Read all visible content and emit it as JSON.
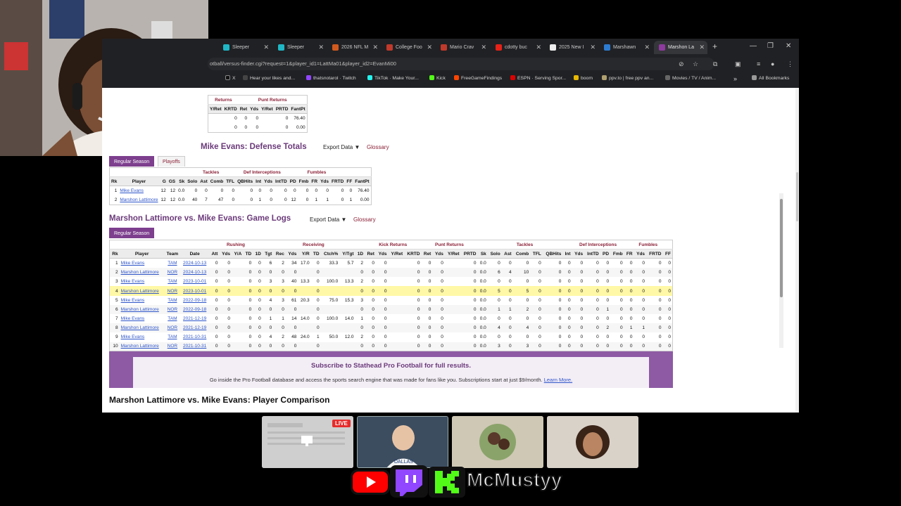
{
  "browser": {
    "tabs": [
      {
        "label": "Sleeper",
        "color": "#1fb7c6"
      },
      {
        "label": "Sleeper",
        "color": "#1fb7c6"
      },
      {
        "label": "2026 NFL M",
        "color": "#d2591e"
      },
      {
        "label": "College Foo",
        "color": "#c0392b"
      },
      {
        "label": "Mario Crav",
        "color": "#c0392b"
      },
      {
        "label": "cdotty buc",
        "color": "#e62117"
      },
      {
        "label": "2025 New I",
        "color": "#eeeeee"
      },
      {
        "label": "Marshawn",
        "color": "#2d7bd1"
      },
      {
        "label": "Marshon La",
        "color": "#8e3a9e"
      }
    ],
    "url": "otball/versus-finder.cgi?request=1&player_id1=LattMa01&player_id2=EvanMi00",
    "bookmarks": [
      "X",
      "Hear your likes and...",
      "thatsnotarol · Twitch",
      "TikTok · Make Your...",
      "Kick",
      "FreeGameFindings",
      "ESPN · Serving Spor...",
      "boom",
      "ppv.to | free ppv an...",
      "Movies / TV / Anim..."
    ],
    "all_bookmarks": "All Bookmarks",
    "overflow": "»"
  },
  "returns_table": {
    "headers_over": [
      "Returns",
      "Punt Returns"
    ],
    "headers": [
      "Y/Ret",
      "KRTD",
      "Ret",
      "Yds",
      "Y/Ret",
      "PRTD",
      "FantPt"
    ],
    "rows": [
      [
        "",
        "0",
        "0",
        "0",
        "",
        "0",
        "76.40"
      ],
      [
        "",
        "0",
        "0",
        "0",
        "",
        "0",
        "0.00"
      ]
    ]
  },
  "defense": {
    "title": "Mike Evans: Defense Totals",
    "export": "Export Data ▼",
    "glossary": "Glossary",
    "tab_regular": "Regular Season",
    "tab_playoffs": "Playoffs",
    "groups": [
      "Tackles",
      "Def Interceptions",
      "Fumbles"
    ],
    "headers": [
      "Rk",
      "Player",
      "G",
      "GS",
      "Sk",
      "Solo",
      "Ast",
      "Comb",
      "TFL",
      "QBHits",
      "Int",
      "Yds",
      "IntTD",
      "PD",
      "Fmb",
      "FR",
      "Yds",
      "FRTD",
      "FF",
      "FantPt"
    ],
    "rows": [
      [
        "1",
        "Mike Evans",
        "12",
        "12",
        "0.0",
        "0",
        "0",
        "0",
        "0",
        "0",
        "0",
        "0",
        "0",
        "0",
        "0",
        "0",
        "0",
        "0",
        "0",
        "76.40"
      ],
      [
        "2",
        "Marshon Lattimore",
        "12",
        "12",
        "0.0",
        "40",
        "7",
        "47",
        "0",
        "0",
        "1",
        "0",
        "0",
        "12",
        "0",
        "1",
        "1",
        "0",
        "1",
        "0.00"
      ]
    ]
  },
  "gamelogs": {
    "title": "Marshon Lattimore vs. Mike Evans: Game Logs",
    "export": "Export Data ▼",
    "glossary": "Glossary",
    "tab_regular": "Regular Season",
    "groups": [
      "Rushing",
      "Receiving",
      "Kick Returns",
      "Punt Returns",
      "Tackles",
      "Def Interceptions",
      "Fumbles"
    ],
    "headers": [
      "Rk",
      "Player",
      "Team",
      "Date",
      "Att",
      "Yds",
      "Y/A",
      "TD",
      "1D",
      "Tgt",
      "Rec",
      "Yds",
      "Y/R",
      "TD",
      "Ctch%",
      "Y/Tgt",
      "1D",
      "Ret",
      "Yds",
      "Y/Ret",
      "KRTD",
      "Ret",
      "Yds",
      "Y/Ret",
      "PRTD",
      "Sk",
      "Solo",
      "Ast",
      "Comb",
      "TFL",
      "QBHits",
      "Int",
      "Yds",
      "IntTD",
      "PD",
      "Fmb",
      "FR",
      "Yds",
      "FRTD",
      "FF"
    ],
    "rows": [
      [
        "1",
        "Mike Evans",
        "TAM",
        "2024-10-13",
        "0",
        "0",
        "",
        "0",
        "0",
        "6",
        "2",
        "34",
        "17.0",
        "0",
        "33.3",
        "5.7",
        "2",
        "0",
        "0",
        "",
        "0",
        "0",
        "0",
        "",
        "0",
        "0.0",
        "0",
        "0",
        "0",
        "0",
        "0",
        "0",
        "0",
        "0",
        "0",
        "0",
        "0",
        "0",
        "0",
        "0"
      ],
      [
        "2",
        "Marshon Lattimore",
        "NOR",
        "2024-10-13",
        "0",
        "0",
        "",
        "0",
        "0",
        "0",
        "0",
        "0",
        "",
        "0",
        "",
        "",
        "0",
        "0",
        "0",
        "",
        "0",
        "0",
        "0",
        "",
        "0",
        "0.0",
        "6",
        "4",
        "10",
        "0",
        "0",
        "0",
        "0",
        "0",
        "0",
        "0",
        "0",
        "0",
        "0",
        "0"
      ],
      [
        "3",
        "Mike Evans",
        "TAM",
        "2023-10-01",
        "0",
        "0",
        "",
        "0",
        "0",
        "3",
        "3",
        "40",
        "13.3",
        "0",
        "100.0",
        "13.3",
        "2",
        "0",
        "0",
        "",
        "0",
        "0",
        "0",
        "",
        "0",
        "0.0",
        "0",
        "0",
        "0",
        "0",
        "0",
        "0",
        "0",
        "0",
        "0",
        "0",
        "0",
        "0",
        "0",
        "0"
      ],
      [
        "4",
        "Marshon Lattimore",
        "NOR",
        "2023-10-01",
        "0",
        "0",
        "",
        "0",
        "0",
        "0",
        "0",
        "0",
        "",
        "0",
        "",
        "",
        "0",
        "0",
        "0",
        "",
        "0",
        "0",
        "0",
        "",
        "0",
        "0.0",
        "5",
        "0",
        "5",
        "0",
        "0",
        "0",
        "0",
        "0",
        "0",
        "0",
        "0",
        "0",
        "0",
        "0"
      ],
      [
        "5",
        "Mike Evans",
        "TAM",
        "2022-09-18",
        "0",
        "0",
        "",
        "0",
        "0",
        "4",
        "3",
        "61",
        "20.3",
        "0",
        "75.0",
        "15.3",
        "3",
        "0",
        "0",
        "",
        "0",
        "0",
        "0",
        "",
        "0",
        "0.0",
        "0",
        "0",
        "0",
        "0",
        "0",
        "0",
        "0",
        "0",
        "0",
        "0",
        "0",
        "0",
        "0",
        "0"
      ],
      [
        "6",
        "Marshon Lattimore",
        "NOR",
        "2022-09-18",
        "0",
        "0",
        "",
        "0",
        "0",
        "0",
        "0",
        "0",
        "",
        "0",
        "",
        "",
        "0",
        "0",
        "0",
        "",
        "0",
        "0",
        "0",
        "",
        "0",
        "0.0",
        "1",
        "1",
        "2",
        "0",
        "0",
        "0",
        "0",
        "0",
        "1",
        "0",
        "0",
        "0",
        "0",
        "0"
      ],
      [
        "7",
        "Mike Evans",
        "TAM",
        "2021-12-19",
        "0",
        "0",
        "",
        "0",
        "0",
        "1",
        "1",
        "14",
        "14.0",
        "0",
        "100.0",
        "14.0",
        "1",
        "0",
        "0",
        "",
        "0",
        "0",
        "0",
        "",
        "0",
        "0.0",
        "0",
        "0",
        "0",
        "0",
        "0",
        "0",
        "0",
        "0",
        "0",
        "0",
        "0",
        "0",
        "0",
        "0"
      ],
      [
        "8",
        "Marshon Lattimore",
        "NOR",
        "2021-12-19",
        "0",
        "0",
        "",
        "0",
        "0",
        "0",
        "0",
        "0",
        "",
        "0",
        "",
        "",
        "0",
        "0",
        "0",
        "",
        "0",
        "0",
        "0",
        "",
        "0",
        "0.0",
        "4",
        "0",
        "4",
        "0",
        "0",
        "0",
        "0",
        "0",
        "2",
        "0",
        "1",
        "1",
        "0",
        "0"
      ],
      [
        "9",
        "Mike Evans",
        "TAM",
        "2021-10-31",
        "0",
        "0",
        "",
        "0",
        "0",
        "4",
        "2",
        "48",
        "24.0",
        "1",
        "50.0",
        "12.0",
        "2",
        "0",
        "0",
        "",
        "0",
        "0",
        "0",
        "",
        "0",
        "0.0",
        "0",
        "0",
        "0",
        "0",
        "0",
        "0",
        "0",
        "0",
        "0",
        "0",
        "0",
        "0",
        "0",
        "0"
      ],
      [
        "10",
        "Marshon Lattimore",
        "NOR",
        "2021-10-31",
        "0",
        "0",
        "",
        "0",
        "0",
        "0",
        "0",
        "0",
        "",
        "0",
        "",
        "",
        "0",
        "0",
        "0",
        "",
        "0",
        "0",
        "0",
        "",
        "0",
        "0.0",
        "3",
        "0",
        "3",
        "0",
        "0",
        "0",
        "0",
        "0",
        "0",
        "0",
        "0",
        "0",
        "0",
        "0"
      ]
    ]
  },
  "promo": {
    "title": "Subscribe to Stathead Pro Football for full results.",
    "body": "Go inside the Pro Football database and access the sports search engine that was made for fans like you. Subscriptions start at just $9/month.",
    "link": "Learn More."
  },
  "comparison_title": "Marshon Lattimore vs. Mike Evans: Player Comparison",
  "overlay": {
    "live": "LIVE",
    "social_name": "McMustyy",
    "jersey_text": "DALLAS"
  },
  "colors": {
    "accent": "#7d3f8e",
    "link": "#2e55c9",
    "highlight": "#fff8a6",
    "youtube": "#ff0000",
    "twitch": "#9146ff",
    "kick": "#53fc18"
  }
}
